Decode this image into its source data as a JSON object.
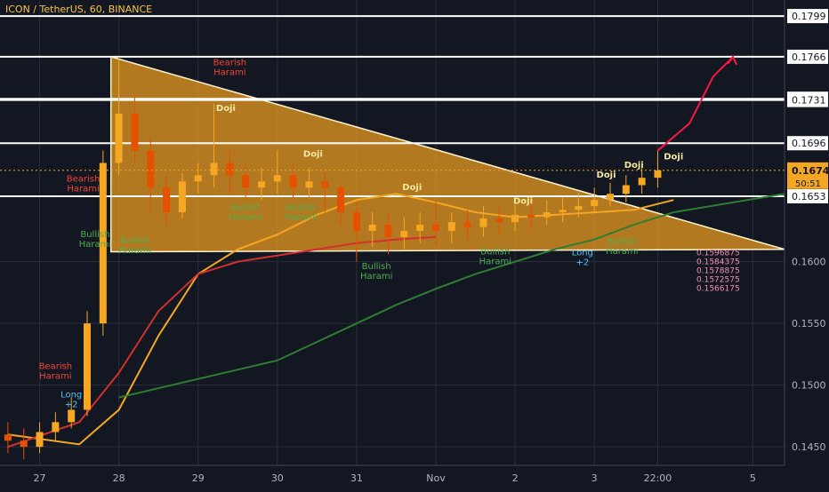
{
  "header": {
    "symbol_title": "ICON / TetherUS, 60, BINANCE"
  },
  "colors": {
    "background": "#131722",
    "triangle_fill": "#f0a020",
    "bullish_label": "#4caf50",
    "bearish_label": "#f44336",
    "doji_label": "#f5e6a0",
    "ma_orange": "#f5a623",
    "ma_green": "#2e7d32",
    "ma_red": "#d32f2f",
    "price_label_bg": "#ffffff",
    "current_price_bg": "#f5a623",
    "projection_arrow": "#ff1744"
  },
  "chart_data": {
    "type": "candlestick",
    "title": "ICON / TetherUS, 60, BINANCE",
    "x_ticks": [
      "27",
      "28",
      "29",
      "30",
      "31",
      "Nov",
      "2",
      "3",
      "22:00",
      "5"
    ],
    "x_tick_pos": [
      0,
      1,
      2,
      3,
      4,
      5,
      6,
      7,
      7.8,
      9
    ],
    "xlim": [
      -0.5,
      9.4
    ],
    "ylim": [
      0.1435,
      0.1812
    ],
    "y_ticks": [
      0.145,
      0.15,
      0.155,
      0.16
    ],
    "horizontal_levels": [
      0.1799,
      0.1766,
      0.1732,
      0.1731,
      0.1696,
      0.1653
    ],
    "level_labels": [
      "0.1799",
      "0.1766",
      "0.1732",
      "0.1731",
      "0.1696",
      "0.1653"
    ],
    "current_price": 0.1674,
    "current_price_label": "0.1674",
    "countdown_label": "50:51",
    "triangle": {
      "upper_line": [
        [
          0.9,
          0.1766
        ],
        [
          9.4,
          0.161
        ]
      ],
      "lower_line": [
        [
          0.9,
          0.1608
        ],
        [
          9.4,
          0.161
        ]
      ]
    },
    "right_ladder_values": [
      "0.1596875",
      "0.1584375",
      "0.1578875",
      "0.1572575",
      "0.1566175"
    ],
    "series": [
      {
        "type": "candles",
        "x": [
          -0.4,
          -0.2,
          0.0,
          0.2,
          0.4,
          0.6,
          0.8,
          1.0,
          1.2,
          1.4,
          1.6,
          1.8,
          2.0,
          2.2,
          2.4,
          2.6,
          2.8,
          3.0,
          3.2,
          3.4,
          3.6,
          3.8,
          4.0,
          4.2,
          4.4,
          4.6,
          4.8,
          5.0,
          5.2,
          5.4,
          5.6,
          5.8,
          6.0,
          6.2,
          6.4,
          6.6,
          6.8,
          7.0,
          7.2,
          7.4,
          7.6,
          7.8
        ],
        "open": [
          0.146,
          0.1455,
          0.145,
          0.1462,
          0.147,
          0.148,
          0.155,
          0.168,
          0.172,
          0.169,
          0.166,
          0.164,
          0.1665,
          0.167,
          0.168,
          0.167,
          0.166,
          0.1665,
          0.167,
          0.166,
          0.1665,
          0.166,
          0.164,
          0.1625,
          0.163,
          0.162,
          0.1625,
          0.163,
          0.1625,
          0.1632,
          0.1628,
          0.1635,
          0.1632,
          0.1638,
          0.1636,
          0.164,
          0.1642,
          0.1645,
          0.165,
          0.1655,
          0.1662,
          0.1668
        ],
        "close": [
          0.1455,
          0.145,
          0.1462,
          0.147,
          0.148,
          0.155,
          0.168,
          0.172,
          0.169,
          0.166,
          0.164,
          0.1665,
          0.167,
          0.168,
          0.167,
          0.166,
          0.1665,
          0.167,
          0.166,
          0.1665,
          0.166,
          0.164,
          0.1625,
          0.163,
          0.162,
          0.1625,
          0.163,
          0.1625,
          0.1632,
          0.1628,
          0.1635,
          0.1632,
          0.1638,
          0.1636,
          0.164,
          0.1642,
          0.1645,
          0.165,
          0.1655,
          0.1662,
          0.1668,
          0.1674
        ],
        "high": [
          0.147,
          0.1465,
          0.147,
          0.1478,
          0.149,
          0.156,
          0.169,
          0.1766,
          0.1735,
          0.17,
          0.167,
          0.1672,
          0.168,
          0.1728,
          0.169,
          0.168,
          0.1676,
          0.169,
          0.168,
          0.1676,
          0.1672,
          0.1662,
          0.1648,
          0.164,
          0.164,
          0.1636,
          0.164,
          0.165,
          0.164,
          0.1642,
          0.1645,
          0.1644,
          0.1646,
          0.1648,
          0.165,
          0.1652,
          0.1656,
          0.166,
          0.1664,
          0.167,
          0.168,
          0.169
        ],
        "low": [
          0.1445,
          0.144,
          0.1445,
          0.1455,
          0.1465,
          0.1475,
          0.154,
          0.167,
          0.168,
          0.164,
          0.163,
          0.1635,
          0.1655,
          0.166,
          0.1655,
          0.165,
          0.165,
          0.1655,
          0.165,
          0.1652,
          0.164,
          0.163,
          0.16,
          0.1612,
          0.1606,
          0.161,
          0.1615,
          0.1612,
          0.1615,
          0.1618,
          0.162,
          0.1622,
          0.1625,
          0.1626,
          0.163,
          0.1632,
          0.1636,
          0.164,
          0.1645,
          0.1648,
          0.1655,
          0.166
        ]
      },
      {
        "type": "line",
        "color": "#f5a623",
        "x": [
          -0.4,
          0.5,
          1.0,
          1.5,
          2.0,
          2.5,
          3.0,
          3.5,
          4.0,
          4.5,
          5.0,
          5.5,
          6.0,
          6.5,
          7.0,
          7.5,
          8.0
        ],
        "y": [
          0.146,
          0.1452,
          0.148,
          0.154,
          0.159,
          0.161,
          0.1622,
          0.1638,
          0.165,
          0.1655,
          0.1648,
          0.164,
          0.1636,
          0.1638,
          0.164,
          0.1642,
          0.165
        ]
      },
      {
        "type": "line",
        "color": "#2e7d32",
        "x": [
          1.0,
          2.0,
          3.0,
          4.0,
          4.5,
          5.0,
          5.5,
          6.0,
          6.5,
          7.0,
          7.5,
          8.0,
          9.4
        ],
        "y": [
          0.149,
          0.1505,
          0.152,
          0.155,
          0.1565,
          0.1578,
          0.159,
          0.16,
          0.161,
          0.1618,
          0.163,
          0.164,
          0.1655
        ]
      },
      {
        "type": "line",
        "color": "#d32f2f",
        "x": [
          -0.4,
          0.5,
          1.0,
          1.5,
          2.0,
          2.5,
          3.0,
          3.5,
          4.0,
          4.5,
          5.0
        ],
        "y": [
          0.145,
          0.147,
          0.151,
          0.156,
          0.159,
          0.16,
          0.1605,
          0.161,
          0.1615,
          0.1618,
          0.162
        ]
      }
    ],
    "annotations": [
      {
        "text": "Bearish",
        "text2": "Harami",
        "x": 2.4,
        "y": 0.1759,
        "kind": "bearish"
      },
      {
        "text": "Bearish",
        "text2": "Harami",
        "x": 0.2,
        "y": 0.1513,
        "kind": "bearish"
      },
      {
        "text": "Bearish",
        "text2": "Harami",
        "x": 0.55,
        "y": 0.1665,
        "kind": "bearish"
      },
      {
        "text": "Bullish",
        "text2": "Harami",
        "x": 0.7,
        "y": 0.162,
        "kind": "bullish"
      },
      {
        "text": "Bullish",
        "text2": "Harami",
        "x": 1.2,
        "y": 0.1615,
        "kind": "bullish"
      },
      {
        "text": "Bullish",
        "text2": "Harami",
        "x": 2.6,
        "y": 0.1642,
        "kind": "bullish"
      },
      {
        "text": "Bullish",
        "text2": "Harami",
        "x": 3.3,
        "y": 0.1642,
        "kind": "bullish"
      },
      {
        "text": "Bullish",
        "text2": "Harami",
        "x": 4.25,
        "y": 0.1594,
        "kind": "bullish"
      },
      {
        "text": "Bullish",
        "text2": "Harami",
        "x": 5.75,
        "y": 0.1606,
        "kind": "bullish"
      },
      {
        "text": "Bullish",
        "text2": "Harami",
        "x": 7.35,
        "y": 0.1614,
        "kind": "bullish"
      },
      {
        "text": "Doji",
        "text2": "",
        "x": 2.35,
        "y": 0.1722,
        "kind": "doji"
      },
      {
        "text": "Doji",
        "text2": "",
        "x": 3.45,
        "y": 0.1685,
        "kind": "doji"
      },
      {
        "text": "Doji",
        "text2": "",
        "x": 4.7,
        "y": 0.1658,
        "kind": "doji"
      },
      {
        "text": "Doji",
        "text2": "",
        "x": 6.1,
        "y": 0.1647,
        "kind": "doji"
      },
      {
        "text": "Doji",
        "text2": "",
        "x": 7.15,
        "y": 0.1668,
        "kind": "doji"
      },
      {
        "text": "Doji",
        "text2": "",
        "x": 7.5,
        "y": 0.1676,
        "kind": "doji"
      },
      {
        "text": "Doji",
        "text2": "",
        "x": 8.0,
        "y": 0.1683,
        "kind": "doji"
      },
      {
        "text": "Long",
        "text2": "+2",
        "x": 0.4,
        "y": 0.149,
        "kind": "long"
      },
      {
        "text": "Long",
        "text2": "+2",
        "x": 6.85,
        "y": 0.1605,
        "kind": "long"
      }
    ],
    "projection": [
      [
        7.8,
        0.169
      ],
      [
        8.2,
        0.1712
      ],
      [
        8.5,
        0.175
      ],
      [
        8.75,
        0.1766
      ]
    ]
  }
}
